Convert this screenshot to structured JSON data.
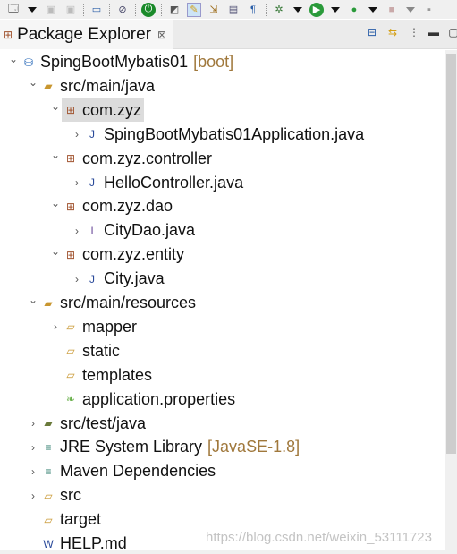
{
  "toolbar": {
    "icons": [
      "new-wizard-icon",
      "save-icon",
      "save-all-icon",
      "terminal-icon",
      "skip-breakpoints-icon",
      "spring-boot-icon",
      "open-type-icon",
      "toggle-mark-occurrences-icon",
      "next-annotation-icon",
      "block-selection-icon",
      "show-whitespace-icon",
      "debug-icon",
      "run-icon",
      "run-external-tool-icon",
      "stop-icon",
      "console-icon"
    ]
  },
  "view": {
    "title": "Package Explorer",
    "close": "⊠"
  },
  "tree": [
    {
      "label": "SpingBootMybatis01",
      "decoration": "[boot]",
      "level": 0,
      "expanded": true,
      "icon": "maven-project-icon"
    },
    {
      "label": "src/main/java",
      "level": 1,
      "expanded": true,
      "icon": "source-folder-icon"
    },
    {
      "label": "com.zyz",
      "level": 2,
      "expanded": true,
      "icon": "package-icon",
      "selected": true
    },
    {
      "label": "SpingBootMybatis01Application.java",
      "level": 3,
      "expanded": false,
      "icon": "java-file-icon"
    },
    {
      "label": "com.zyz.controller",
      "level": 2,
      "expanded": true,
      "icon": "package-icon"
    },
    {
      "label": "HelloController.java",
      "level": 3,
      "expanded": false,
      "icon": "java-file-icon"
    },
    {
      "label": "com.zyz.dao",
      "level": 2,
      "expanded": true,
      "icon": "package-icon"
    },
    {
      "label": "CityDao.java",
      "level": 3,
      "expanded": false,
      "icon": "java-interface-file-icon"
    },
    {
      "label": "com.zyz.entity",
      "level": 2,
      "expanded": true,
      "icon": "package-icon"
    },
    {
      "label": "City.java",
      "level": 3,
      "expanded": false,
      "icon": "java-file-icon"
    },
    {
      "label": "src/main/resources",
      "level": 1,
      "expanded": true,
      "icon": "source-folder-icon"
    },
    {
      "label": "mapper",
      "level": 2,
      "expanded": false,
      "icon": "folder-icon"
    },
    {
      "label": "static",
      "level": 2,
      "icon": "folder-icon"
    },
    {
      "label": "templates",
      "level": 2,
      "icon": "folder-icon"
    },
    {
      "label": "application.properties",
      "level": 2,
      "icon": "spring-properties-icon"
    },
    {
      "label": "src/test/java",
      "level": 1,
      "expanded": false,
      "icon": "test-source-folder-icon"
    },
    {
      "label": "JRE System Library",
      "decoration": "[JavaSE-1.8]",
      "level": 1,
      "expanded": false,
      "icon": "library-icon"
    },
    {
      "label": "Maven Dependencies",
      "level": 1,
      "expanded": false,
      "icon": "library-icon"
    },
    {
      "label": "src",
      "level": 1,
      "expanded": false,
      "icon": "folder-icon"
    },
    {
      "label": "target",
      "level": 1,
      "icon": "folder-icon"
    },
    {
      "label": "HELP.md",
      "level": 1,
      "icon": "markdown-file-icon"
    }
  ],
  "watermark": "https://blog.csdn.net/weixin_53111723"
}
